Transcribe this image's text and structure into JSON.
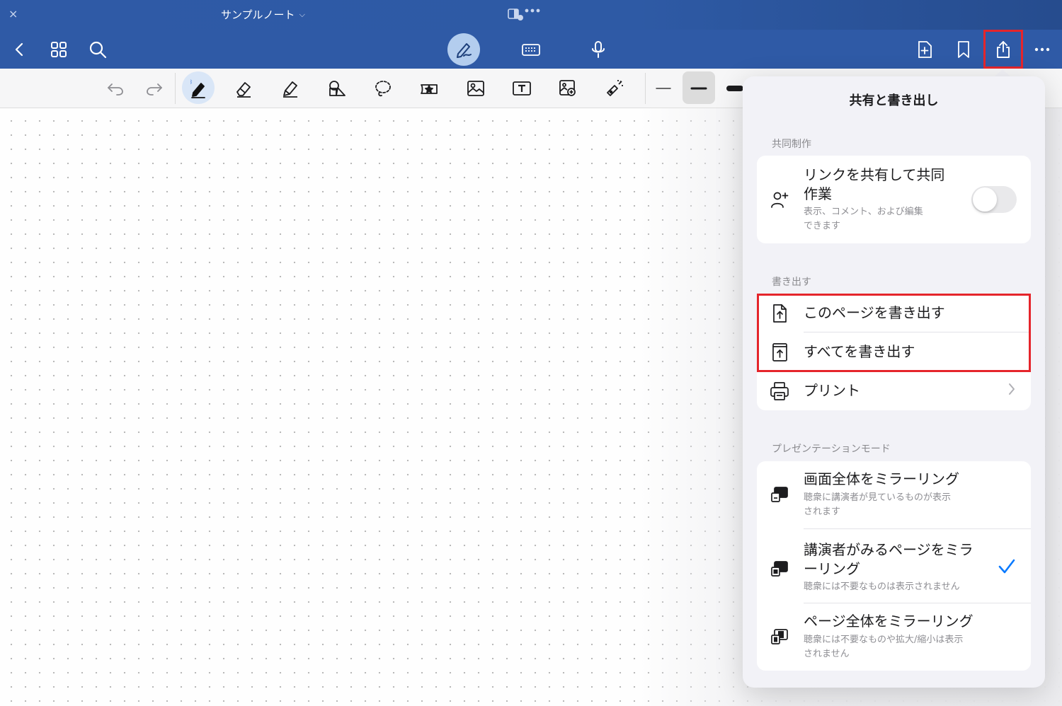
{
  "titlebar": {
    "close_symbol": "×",
    "note_title": "サンプルノート",
    "title_chevron": "⌵"
  },
  "navbar": {
    "icons": [
      "back-icon",
      "grid-icon",
      "search-icon",
      "pen-mode-icon",
      "keyboard-icon",
      "microphone-icon",
      "add-page-icon",
      "bookmark-icon",
      "share-icon",
      "more-icon"
    ]
  },
  "toolbar": {
    "icons": [
      "undo-icon",
      "redo-icon",
      "pen-icon",
      "eraser-icon",
      "highlighter-icon",
      "shapes-icon",
      "lasso-icon",
      "sticker-icon",
      "image-icon",
      "text-box-icon",
      "camera-icon",
      "laser-pointer-icon",
      "thin-stroke-icon",
      "medium-stroke-icon",
      "thick-stroke-icon"
    ]
  },
  "colors": {
    "accent_blue": "#2f5aa6",
    "highlight_red": "#e5252b",
    "check_blue": "#0a7aff"
  },
  "popover": {
    "title": "共有と書き出し",
    "collab": {
      "section_label": "共同制作",
      "title_line1": "リンクを共有して共同",
      "title_line2": "作業",
      "sub_line1": "表示、コメント、および編集",
      "sub_line2": "できます",
      "toggle_on": false
    },
    "export": {
      "section_label": "書き出す",
      "export_page": "このページを書き出す",
      "export_all": "すべてを書き出す",
      "print": "プリント"
    },
    "presentation": {
      "section_label": "プレゼンテーションモード",
      "mirror_screen": {
        "title": "画面全体をミラーリング",
        "sub_line1": "聴衆に講演者が見ているものが表示",
        "sub_line2": "されます"
      },
      "mirror_presenter": {
        "title_line1": "講演者がみるページをミラ",
        "title_line2": "ーリング",
        "sub": "聴衆には不要なものは表示されません",
        "selected": true
      },
      "mirror_page": {
        "title": "ページ全体をミラーリング",
        "sub_line1": "聴衆には不要なものや拡大/縮小は表示",
        "sub_line2": "されません"
      }
    }
  }
}
